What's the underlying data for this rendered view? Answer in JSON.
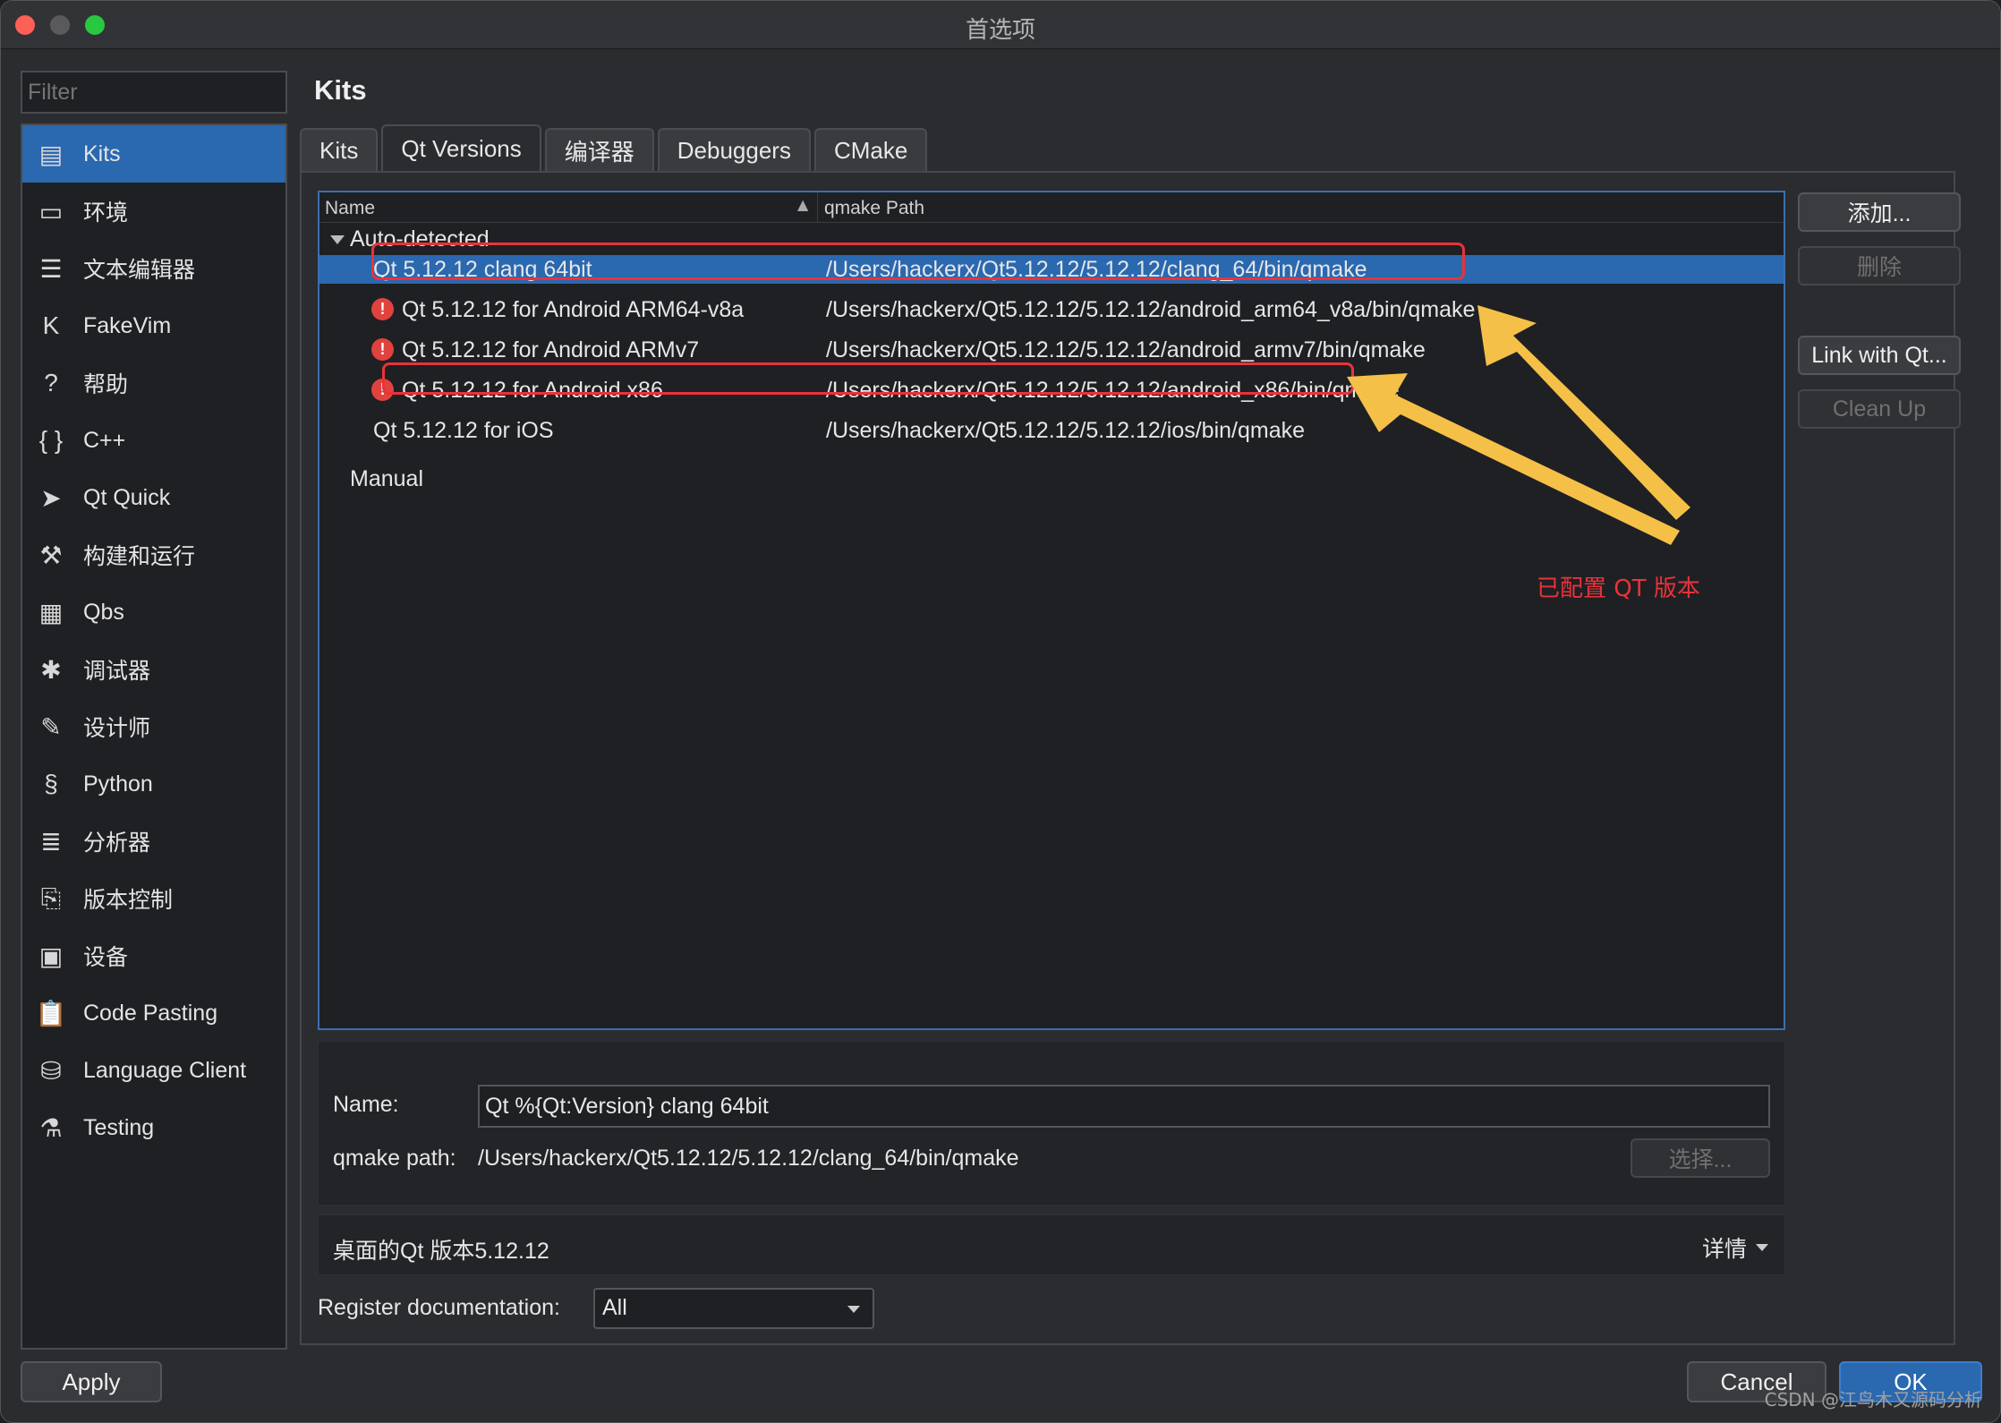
{
  "window": {
    "title": "首选项"
  },
  "filter": {
    "placeholder": "Filter"
  },
  "sidebar": {
    "items": [
      {
        "label": "Kits",
        "icon": "kits-icon",
        "glyph": "▤",
        "active": true
      },
      {
        "label": "环境",
        "icon": "monitor-icon",
        "glyph": "▭"
      },
      {
        "label": "文本编辑器",
        "icon": "text-editor-icon",
        "glyph": "☰"
      },
      {
        "label": "FakeVim",
        "icon": "fakevim-icon",
        "glyph": "K"
      },
      {
        "label": "帮助",
        "icon": "help-icon",
        "glyph": "?"
      },
      {
        "label": "C++",
        "icon": "braces-icon",
        "glyph": "{ }"
      },
      {
        "label": "Qt Quick",
        "icon": "paper-plane-icon",
        "glyph": "➤"
      },
      {
        "label": "构建和运行",
        "icon": "hammer-icon",
        "glyph": "⚒"
      },
      {
        "label": "Qbs",
        "icon": "grid-icon",
        "glyph": "▦"
      },
      {
        "label": "调试器",
        "icon": "bug-icon",
        "glyph": "✱"
      },
      {
        "label": "设计师",
        "icon": "pencil-icon",
        "glyph": "✎"
      },
      {
        "label": "Python",
        "icon": "python-icon",
        "glyph": "§"
      },
      {
        "label": "分析器",
        "icon": "analyzer-icon",
        "glyph": "≣"
      },
      {
        "label": "版本控制",
        "icon": "version-control-icon",
        "glyph": "⎘"
      },
      {
        "label": "设备",
        "icon": "device-icon",
        "glyph": "▣"
      },
      {
        "label": "Code Pasting",
        "icon": "clipboard-icon",
        "glyph": "📋"
      },
      {
        "label": "Language Client",
        "icon": "language-client-icon",
        "glyph": "⛁"
      },
      {
        "label": "Testing",
        "icon": "flask-icon",
        "glyph": "⚗"
      }
    ]
  },
  "page": {
    "title": "Kits"
  },
  "tabs": [
    {
      "label": "Kits",
      "active": false
    },
    {
      "label": "Qt Versions",
      "active": true
    },
    {
      "label": "编译器",
      "active": false
    },
    {
      "label": "Debuggers",
      "active": false
    },
    {
      "label": "CMake",
      "active": false
    }
  ],
  "tree": {
    "columns": {
      "name": "Name",
      "path": "qmake Path"
    },
    "group_auto": "Auto-detected",
    "rows": [
      {
        "name": "Qt 5.12.12 clang 64bit",
        "path": "/Users/hackerx/Qt5.12.12/5.12.12/clang_64/bin/qmake",
        "warning": false,
        "selected": true
      },
      {
        "name": "Qt 5.12.12 for Android ARM64-v8a",
        "path": "/Users/hackerx/Qt5.12.12/5.12.12/android_arm64_v8a/bin/qmake",
        "warning": true,
        "selected": false
      },
      {
        "name": "Qt 5.12.12 for Android ARMv7",
        "path": "/Users/hackerx/Qt5.12.12/5.12.12/android_armv7/bin/qmake",
        "warning": true,
        "selected": false
      },
      {
        "name": "Qt 5.12.12 for Android x86",
        "path": "/Users/hackerx/Qt5.12.12/5.12.12/android_x86/bin/qmake",
        "warning": true,
        "selected": false
      },
      {
        "name": "Qt 5.12.12 for iOS",
        "path": "/Users/hackerx/Qt5.12.12/5.12.12/ios/bin/qmake",
        "warning": false,
        "selected": false
      }
    ],
    "group_manual": "Manual"
  },
  "buttons": {
    "add": "添加...",
    "remove": "删除",
    "link": "Link with Qt...",
    "cleanup": "Clean Up",
    "choose": "选择...",
    "apply": "Apply",
    "cancel": "Cancel",
    "ok": "OK"
  },
  "annotation": {
    "text": "已配置 QT 版本",
    "color": "#e8333b"
  },
  "details": {
    "name_label": "Name:",
    "name_value": "Qt %{Qt:Version} clang 64bit",
    "qmake_label": "qmake path:",
    "qmake_value": "/Users/hackerx/Qt5.12.12/5.12.12/clang_64/bin/qmake"
  },
  "summary": {
    "text": "桌面的Qt 版本5.12.12",
    "details_label": "详情"
  },
  "register": {
    "label": "Register documentation:",
    "value": "All"
  },
  "watermark": "CSDN @江鸟木又源码分析",
  "colors": {
    "accent": "#2a68b0",
    "highlight": "#e8333b",
    "arrow": "#f5c048",
    "warning": "#e0433e"
  }
}
